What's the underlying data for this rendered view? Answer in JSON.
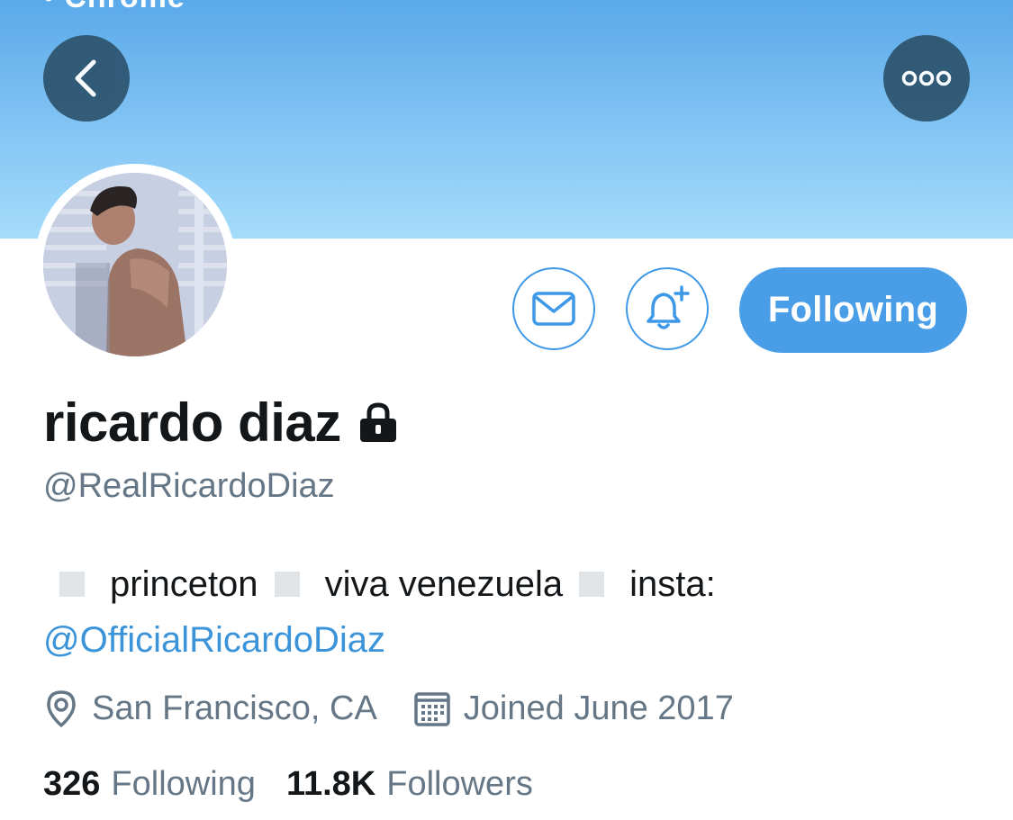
{
  "status_bar": {
    "text": "• Chrome"
  },
  "header": {
    "back_icon": "chevron-left-icon",
    "more_icon": "ellipsis-icon"
  },
  "profile": {
    "name": "ricardo diaz",
    "handle": "@RealRicardoDiaz",
    "protected_icon": "lock-icon",
    "avatar": "profile-photo"
  },
  "actions": {
    "message_icon": "envelope-icon",
    "notify_icon": "bell-plus-icon",
    "follow_label": "Following"
  },
  "bio": {
    "part1": "princeton",
    "part2": "viva venezuela",
    "part3": "insta:",
    "link": "@OfficialRicardoDiaz"
  },
  "meta": {
    "location": "San Francisco, CA",
    "joined": "Joined June 2017"
  },
  "stats": {
    "following_count": "326",
    "following_label": "Following",
    "followers_count": "11.8K",
    "followers_label": "Followers"
  },
  "colors": {
    "accent": "#4a9ee8",
    "link": "#3b94d9",
    "secondary_text": "#657786",
    "banner_top": "#5aa9ea",
    "banner_bottom": "#a6dcfb",
    "overlay_button": "#2f5773"
  }
}
